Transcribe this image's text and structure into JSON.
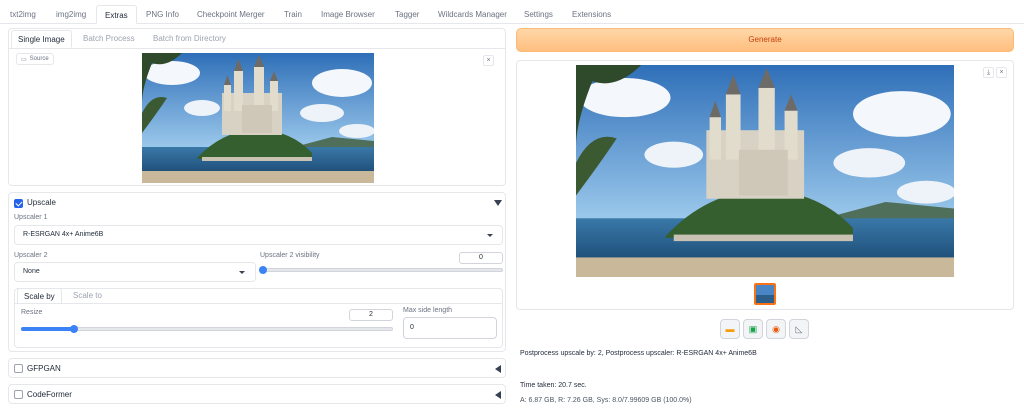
{
  "tabs": [
    "txt2img",
    "img2img",
    "Extras",
    "PNG Info",
    "Checkpoint Merger",
    "Train",
    "Image Browser",
    "Tagger",
    "Wildcards Manager",
    "Settings",
    "Extensions"
  ],
  "sub_tabs": [
    "Single Image",
    "Batch Process",
    "Batch from Directory"
  ],
  "source_label": "Source",
  "close_glyph": "×",
  "download_glyph": "⤓",
  "generate_label": "Generate",
  "upscale": {
    "title": "Upscale",
    "checked": true,
    "upscaler1_label": "Upscaler 1",
    "upscaler1_value": "R-ESRGAN 4x+ Anime6B",
    "upscaler2_label": "Upscaler 2",
    "upscaler2_value": "None",
    "visibility_label": "Upscaler 2 visibility",
    "visibility_value": "0",
    "visibility_fraction": 0,
    "scale_tabs": [
      "Scale by",
      "Scale to"
    ],
    "resize_label": "Resize",
    "resize_value": "2",
    "resize_fraction": 0.143,
    "max_side_label": "Max side length",
    "max_side_value": "0"
  },
  "sections": [
    {
      "title": "GFPGAN",
      "checked": false
    },
    {
      "title": "CodeFormer",
      "checked": false
    }
  ],
  "tool_icons": [
    "folder-icon",
    "image-icon",
    "palette-icon",
    "ruler-icon"
  ],
  "output": {
    "postprocess_text": "Postprocess upscale by: 2, Postprocess upscaler: R-ESRGAN 4x+ Anime6B",
    "time_taken": "Time taken: 20.7 sec.",
    "memory": "A: 6.87 GB, R: 7.26 GB, Sys: 8.0/7.99609 GB (100.0%)"
  }
}
